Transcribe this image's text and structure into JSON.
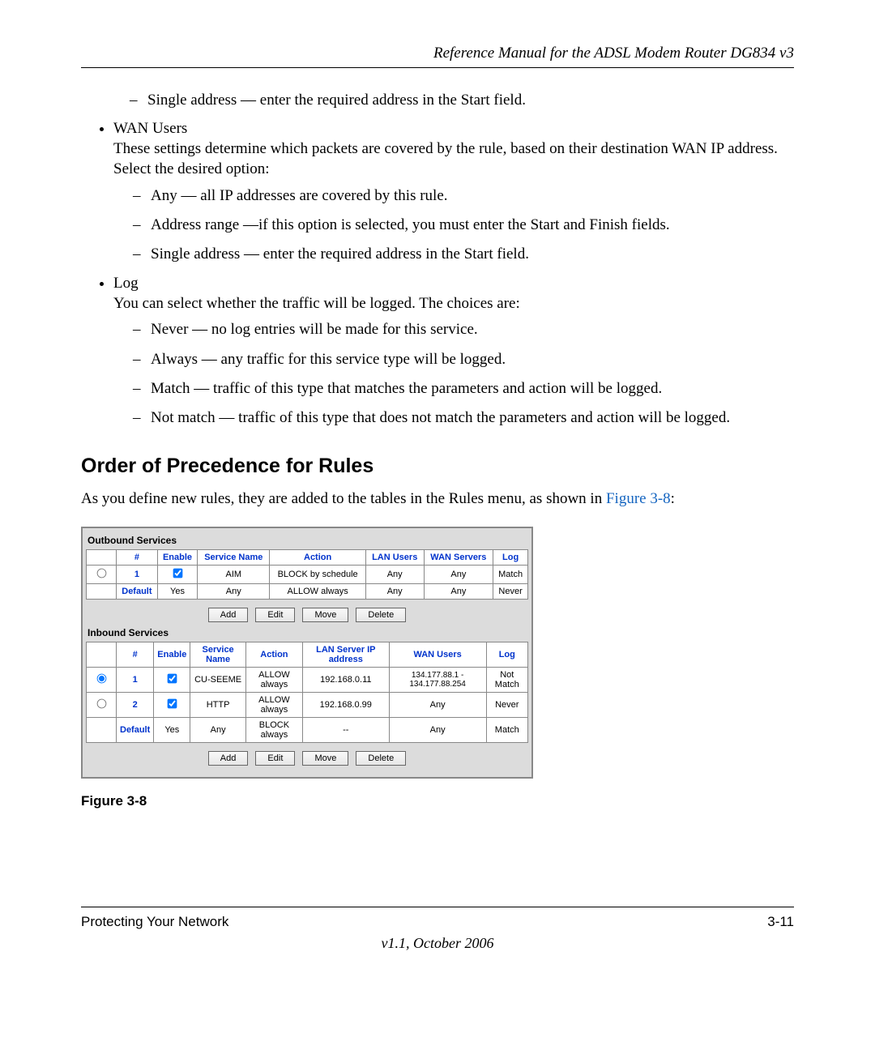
{
  "header": "Reference Manual for the ADSL Modem Router DG834 v3",
  "body": {
    "single_intro": "Single address — enter the required address in the Start field.",
    "wan_title": "WAN Users",
    "wan_desc": "These settings determine which packets are covered by the rule, based on their destination WAN IP address. Select the desired option:",
    "wan_items": [
      "Any — all IP addresses are covered by this rule.",
      "Address range —if this option is selected, you must enter the Start and Finish fields.",
      "Single address — enter the required address in the Start field."
    ],
    "log_title": "Log",
    "log_desc": "You can select whether the traffic will be logged. The choices are:",
    "log_items": [
      "Never — no log entries will be made for this service.",
      "Always — any traffic for this service type will be logged.",
      "Match — traffic of this type that matches the parameters and action will be logged.",
      "Not match — traffic of this type that does not match the parameters and action will be logged."
    ],
    "section_title": "Order of Precedence for Rules",
    "section_para_a": "As you define new rules, they are added to the tables in the Rules menu, as shown in ",
    "section_para_ref": "Figure 3-8",
    "section_para_b": ":"
  },
  "figure": {
    "caption": "Figure 3-8",
    "outbound": {
      "title": "Outbound Services",
      "headers": [
        "#",
        "Enable",
        "Service Name",
        "Action",
        "LAN Users",
        "WAN Servers",
        "Log"
      ],
      "rows": [
        {
          "radio": false,
          "num": "1",
          "enable": true,
          "service": "AIM",
          "action": "BLOCK by schedule",
          "lan": "Any",
          "wan": "Any",
          "log": "Match"
        },
        {
          "radio": null,
          "num": "Default",
          "enable_text": "Yes",
          "service": "Any",
          "action": "ALLOW always",
          "lan": "Any",
          "wan": "Any",
          "log": "Never"
        }
      ]
    },
    "inbound": {
      "title": "Inbound Services",
      "headers": [
        "#",
        "Enable",
        "Service Name",
        "Action",
        "LAN Server IP address",
        "WAN Users",
        "Log"
      ],
      "rows": [
        {
          "radio": true,
          "num": "1",
          "enable": true,
          "service": "CU-SEEME",
          "action": "ALLOW always",
          "lan": "192.168.0.11",
          "wan": "134.177.88.1 - 134.177.88.254",
          "log": "Not Match"
        },
        {
          "radio": false,
          "num": "2",
          "enable": true,
          "service": "HTTP",
          "action": "ALLOW always",
          "lan": "192.168.0.99",
          "wan": "Any",
          "log": "Never"
        },
        {
          "radio": null,
          "num": "Default",
          "enable_text": "Yes",
          "service": "Any",
          "action": "BLOCK always",
          "lan": "--",
          "wan": "Any",
          "log": "Match"
        }
      ]
    },
    "buttons": [
      "Add",
      "Edit",
      "Move",
      "Delete"
    ]
  },
  "footer": {
    "left": "Protecting Your Network",
    "right": "3-11",
    "version": "v1.1, October 2006"
  }
}
